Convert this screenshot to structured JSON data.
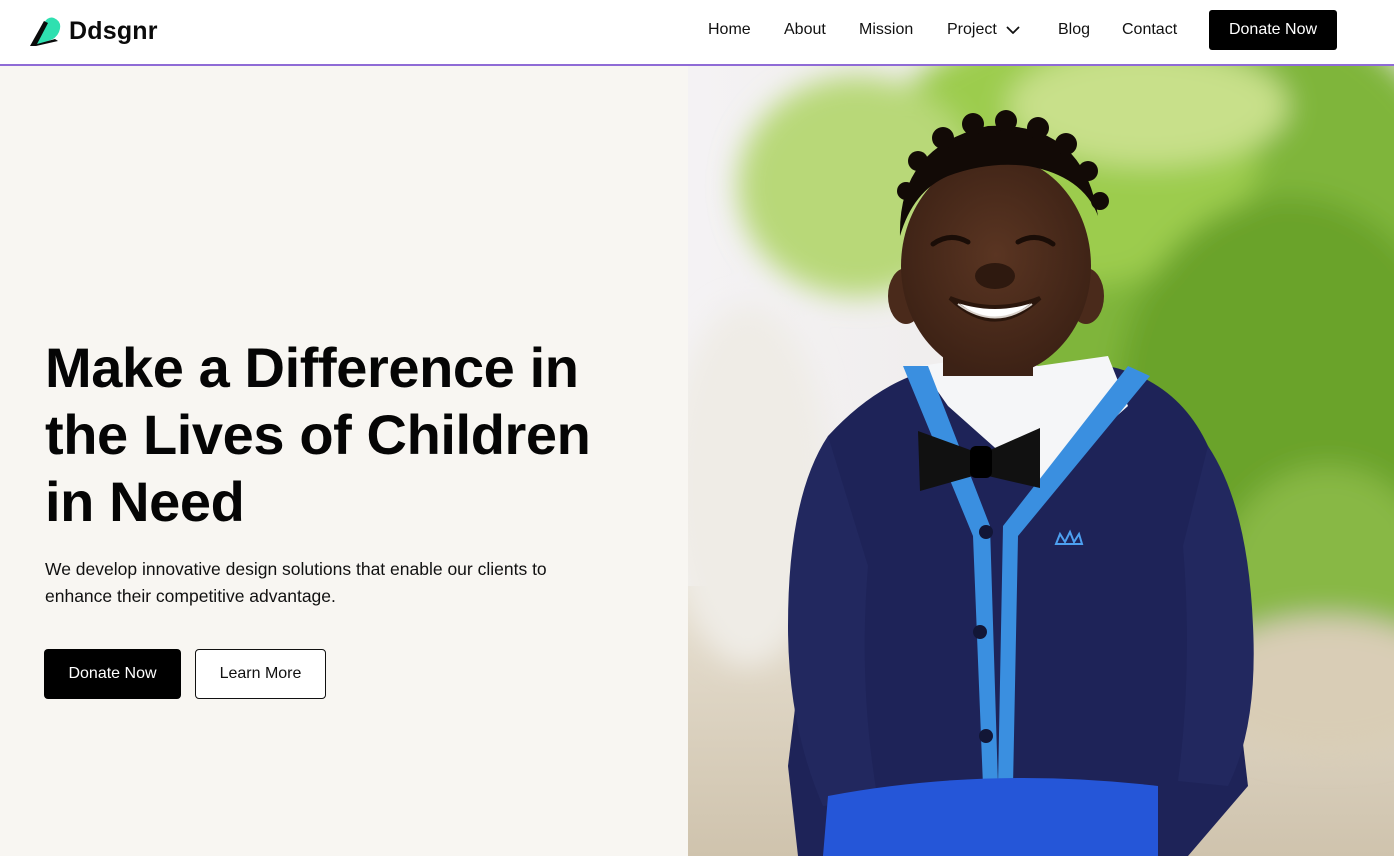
{
  "brand": {
    "name": "Ddsgnr",
    "icon": "leaf-logo-icon",
    "colors": {
      "mark_dark": "#0b0b0b",
      "mark_accent": "#2fe0b0"
    }
  },
  "nav": {
    "items": [
      {
        "label": "Home"
      },
      {
        "label": "About"
      },
      {
        "label": "Mission"
      },
      {
        "label": "Project",
        "icon": "chevron-down-icon"
      },
      {
        "label": "Blog"
      },
      {
        "label": "Contact"
      }
    ],
    "cta_label": "Donate Now"
  },
  "hero": {
    "title": "Make a Difference in the Lives of Children in Need",
    "description": "We develop innovative design solutions that enable our clients to enhance their competitive advantage.",
    "primary_button": "Donate Now",
    "secondary_button": "Learn More",
    "image": "smiling-child-photo"
  },
  "theme": {
    "page_bg": "#ffffff",
    "hero_left_bg": "#f8f6f2",
    "header_divider": "#8f6bd6",
    "button_dark": "#000000"
  }
}
